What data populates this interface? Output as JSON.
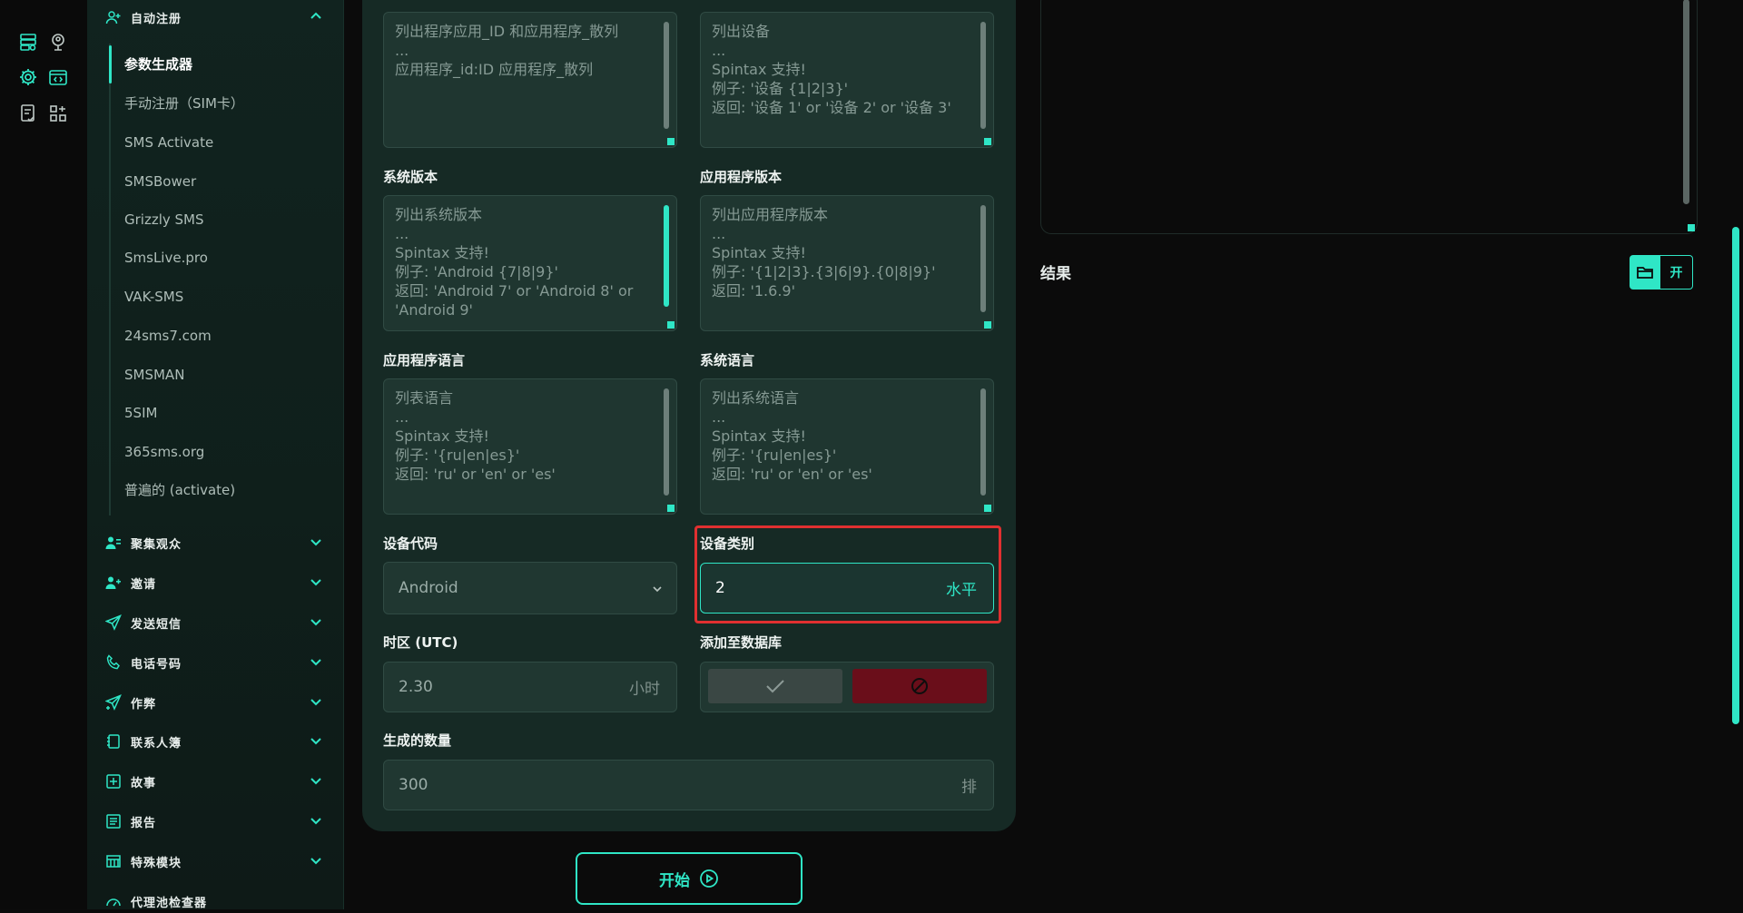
{
  "sidebar": {
    "top_group": {
      "label": "自动注册"
    },
    "sub_items": [
      {
        "label": "参数生成器"
      },
      {
        "label": "手动注册（SIM卡）"
      },
      {
        "label": "SMS Activate"
      },
      {
        "label": "SMSBower"
      },
      {
        "label": "Grizzly SMS"
      },
      {
        "label": "SmsLive.pro"
      },
      {
        "label": "VAK-SMS"
      },
      {
        "label": "24sms7.com"
      },
      {
        "label": "SMSMAN"
      },
      {
        "label": "5SIM"
      },
      {
        "label": "365sms.org"
      },
      {
        "label": "普遍的 (activate)"
      }
    ],
    "groups": [
      {
        "label": "聚集观众",
        "icon": "users-icon"
      },
      {
        "label": "邀请",
        "icon": "user-plus-icon"
      },
      {
        "label": "发送短信",
        "icon": "send-icon"
      },
      {
        "label": "电话号码",
        "icon": "phone-icon"
      },
      {
        "label": "作弊",
        "icon": "send-plus-icon"
      },
      {
        "label": "联系人簿",
        "icon": "contacts-book-icon"
      },
      {
        "label": "故事",
        "icon": "plus-square-icon"
      },
      {
        "label": "报告",
        "icon": "report-icon"
      },
      {
        "label": "特殊模块",
        "icon": "grid-table-icon"
      },
      {
        "label": "代理池检查器",
        "icon": "gauge-icon"
      }
    ]
  },
  "form": {
    "app_id_hash": {
      "placeholder": "列出程序应用_ID 和应用程序_散列\n...\n应用程序_id:ID 应用程序_散列"
    },
    "device": {
      "placeholder": "列出设备\n...\nSpintax 支持!\n例子: '设备 {1|2|3}'\n返回: '设备 1' or '设备 2' or '设备 3'"
    },
    "system_version": {
      "label": "系统版本",
      "placeholder": "列出系统版本\n...\nSpintax 支持!\n例子: 'Android {7|8|9}'\n返回: 'Android 7' or 'Android 8' or 'Android 9'"
    },
    "app_version": {
      "label": "应用程序版本",
      "placeholder": "列出应用程序版本\n...\nSpintax 支持!\n例子: '{1|2|3}.{3|6|9}.{0|8|9}'\n返回: '1.6.9'"
    },
    "app_language": {
      "label": "应用程序语言",
      "placeholder": "列表语言\n...\nSpintax 支持!\n例子: '{ru|en|es}'\n返回: 'ru' or 'en' or 'es'"
    },
    "system_language": {
      "label": "系统语言",
      "placeholder": "列出系统语言\n...\nSpintax 支持!\n例子: '{ru|en|es}'\n返回: 'ru' or 'en' or 'es'"
    },
    "device_code": {
      "label": "设备代码",
      "value": "Android"
    },
    "device_category": {
      "label": "设备类别",
      "value": "2",
      "suffix": "水平"
    },
    "timezone": {
      "label": "时区 (UTC)",
      "value": "2.30",
      "suffix": "小时"
    },
    "add_to_db": {
      "label": "添加至数据库"
    },
    "generate_count": {
      "label": "生成的数量",
      "value": "300",
      "suffix": "排"
    }
  },
  "start_button": {
    "label": "开始"
  },
  "result": {
    "label": "结果",
    "open_label": "开"
  },
  "colors": {
    "accent": "#2fe6c6",
    "panel": "#162a25",
    "danger": "#6a0e1a",
    "highlight": "#e03030"
  }
}
